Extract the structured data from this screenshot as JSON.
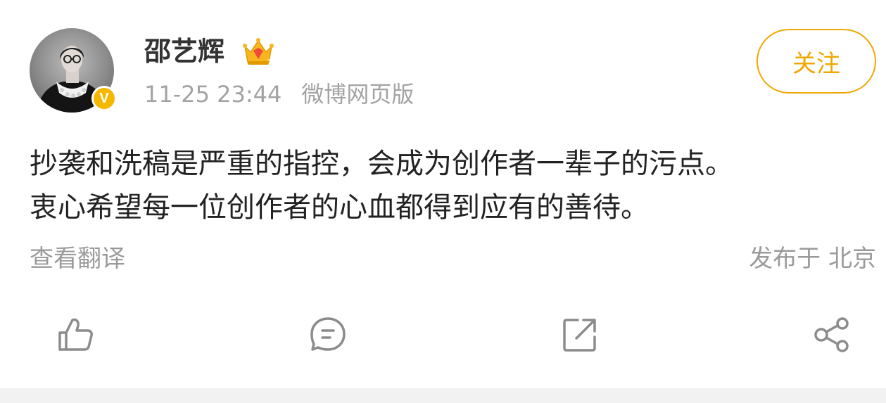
{
  "post": {
    "author": {
      "name": "邵艺辉",
      "verified_badge": "V",
      "member_badge_icon": "crown-icon"
    },
    "meta": {
      "time": "11-25 23:44",
      "source": "微博网页版"
    },
    "follow_label": "关注",
    "content": {
      "line1": "抄袭和洗稿是严重的指控，会成为创作者一辈子的污点。",
      "line2": "衷心希望每一位创作者的心血都得到应有的善待。"
    },
    "translate_label": "查看翻译",
    "location": "发布于 北京"
  },
  "actions": [
    {
      "name": "like",
      "icon": "thumbs-up-icon"
    },
    {
      "name": "comment",
      "icon": "comment-icon"
    },
    {
      "name": "repost",
      "icon": "repost-icon"
    },
    {
      "name": "share",
      "icon": "share-icon"
    }
  ],
  "colors": {
    "accent": "#f0a800",
    "verified": "#f5b800",
    "text_primary": "#222222",
    "text_secondary": "#a3a3a3",
    "icon": "#8c8c8c"
  }
}
